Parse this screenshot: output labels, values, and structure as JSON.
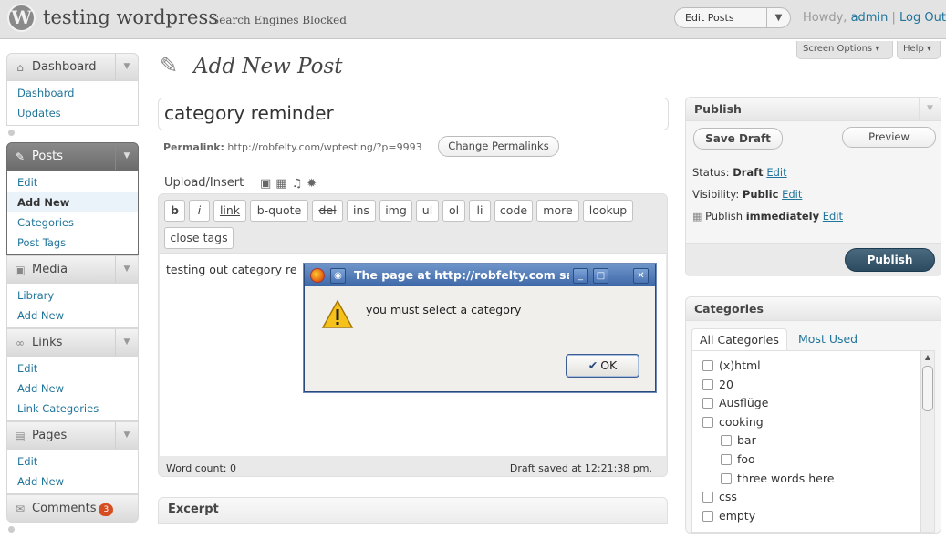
{
  "header": {
    "logo_letter": "W",
    "site_title": "testing wordpress",
    "site_status": "Search Engines Blocked",
    "favorites_label": "Edit Posts",
    "howdy_prefix": "Howdy,",
    "username": "admin",
    "separator": "|",
    "logout": "Log Out",
    "screen_options": "Screen Options ▾",
    "help": "Help ▾"
  },
  "menu": {
    "dashboard": {
      "label": "Dashboard",
      "items": [
        "Dashboard",
        "Updates"
      ]
    },
    "posts": {
      "label": "Posts",
      "items": [
        "Edit",
        "Add New",
        "Categories",
        "Post Tags"
      ]
    },
    "media": {
      "label": "Media",
      "items": [
        "Library",
        "Add New"
      ]
    },
    "links": {
      "label": "Links",
      "items": [
        "Edit",
        "Add New",
        "Link Categories"
      ]
    },
    "pages": {
      "label": "Pages",
      "items": [
        "Edit",
        "Add New"
      ]
    },
    "comments": {
      "label": "Comments",
      "count": "3"
    }
  },
  "page_title": "Add New Post",
  "post": {
    "title": "category reminder",
    "permalink_label": "Permalink:",
    "permalink_url": "http://robfelty.com/wptesting/?p=9993",
    "change_permalinks": "Change Permalinks",
    "upload_insert": "Upload/Insert",
    "content": "testing out category re",
    "word_count": "Word count: 0",
    "draft_saved": "Draft saved at 12:21:38 pm."
  },
  "quicktags": [
    "b",
    "i",
    "link",
    "b-quote",
    "del",
    "ins",
    "img",
    "ul",
    "ol",
    "li",
    "code",
    "more",
    "lookup",
    "close tags"
  ],
  "excerpt_title": "Excerpt",
  "publish": {
    "title": "Publish",
    "save_draft": "Save Draft",
    "preview": "Preview",
    "status_label": "Status:",
    "status_value": "Draft",
    "visibility_label": "Visibility:",
    "visibility_value": "Public",
    "publish_label": "Publish",
    "publish_value": "immediately",
    "edit": "Edit",
    "publish_button": "Publish"
  },
  "categories": {
    "title": "Categories",
    "tab_all": "All Categories",
    "tab_used": "Most Used",
    "items": [
      {
        "name": "(x)html",
        "level": 0
      },
      {
        "name": "20",
        "level": 0
      },
      {
        "name": "Ausflüge",
        "level": 0
      },
      {
        "name": "cooking",
        "level": 0
      },
      {
        "name": "bar",
        "level": 1
      },
      {
        "name": "foo",
        "level": 1
      },
      {
        "name": "three words here",
        "level": 1
      },
      {
        "name": "css",
        "level": 0
      },
      {
        "name": "empty",
        "level": 0
      }
    ]
  },
  "dialog": {
    "title": "The page at http://robfelty.com says:",
    "message": "you must select a category",
    "ok": "OK"
  },
  "colors": {
    "link": "#21759b",
    "publish_button": "#2c4a60",
    "dialog_title": "#3e67a8"
  }
}
